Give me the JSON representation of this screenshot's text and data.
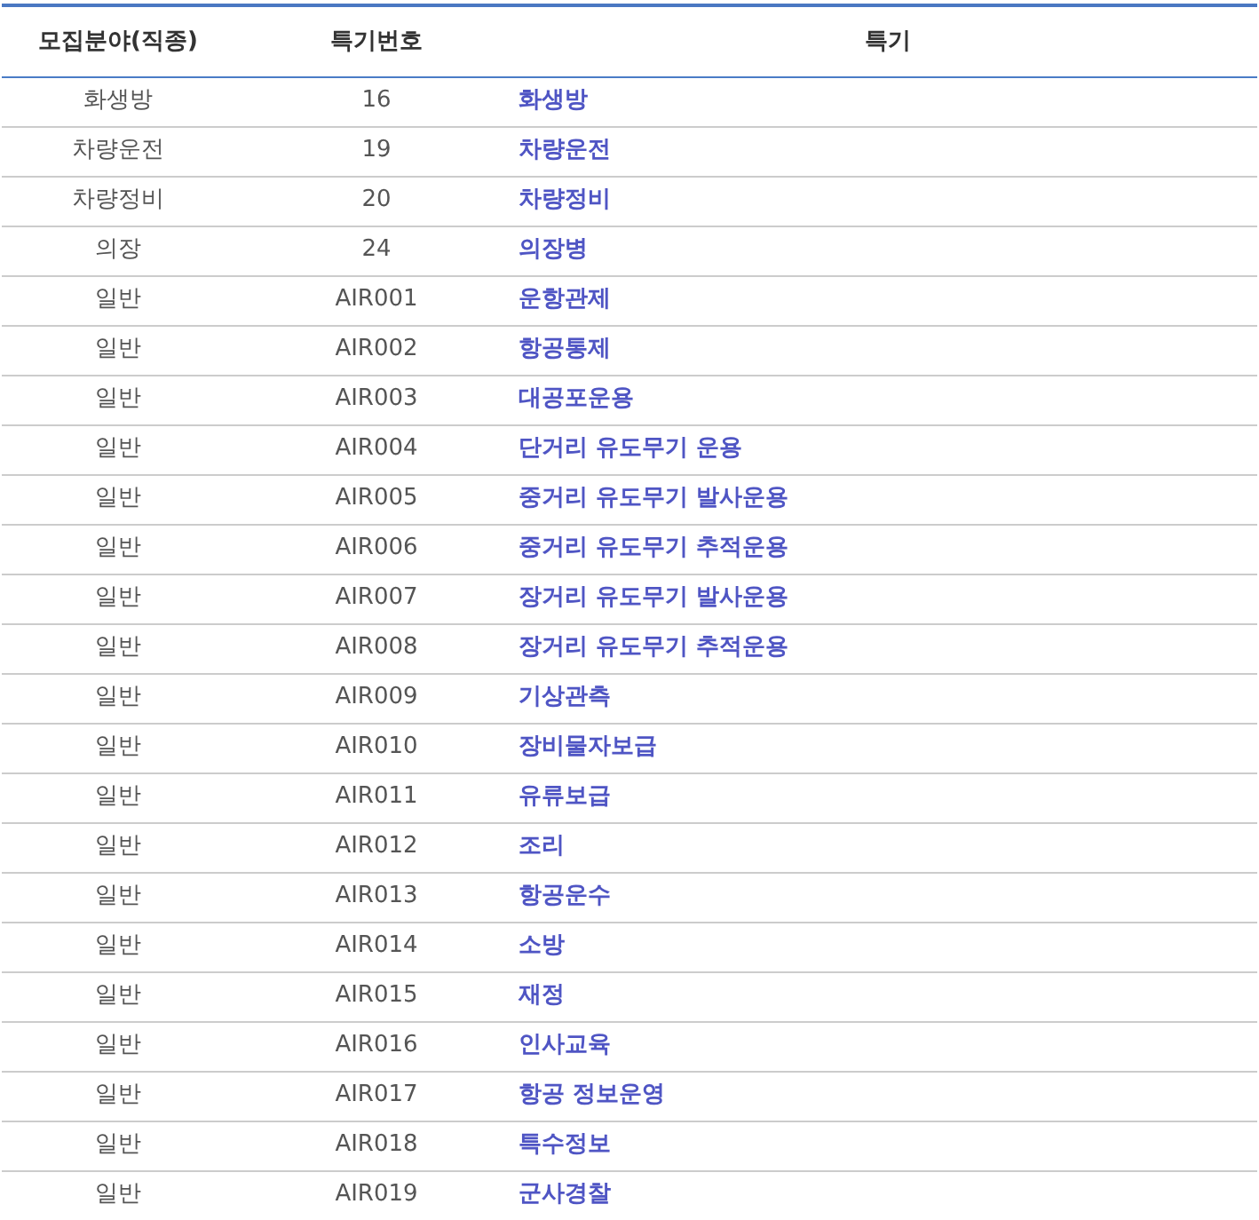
{
  "table": {
    "columns": [
      "모집분야(직종)",
      "특기번호",
      "특기"
    ],
    "rows": [
      {
        "field": "화생방",
        "code": "16",
        "specialty": "화생방"
      },
      {
        "field": "차량운전",
        "code": "19",
        "specialty": "차량운전"
      },
      {
        "field": "차량정비",
        "code": "20",
        "specialty": "차량정비"
      },
      {
        "field": "의장",
        "code": "24",
        "specialty": "의장병"
      },
      {
        "field": "일반",
        "code": "AIR001",
        "specialty": "운항관제"
      },
      {
        "field": "일반",
        "code": "AIR002",
        "specialty": "항공통제"
      },
      {
        "field": "일반",
        "code": "AIR003",
        "specialty": "대공포운용"
      },
      {
        "field": "일반",
        "code": "AIR004",
        "specialty": "단거리 유도무기 운용"
      },
      {
        "field": "일반",
        "code": "AIR005",
        "specialty": "중거리 유도무기 발사운용"
      },
      {
        "field": "일반",
        "code": "AIR006",
        "specialty": "중거리 유도무기 추적운용"
      },
      {
        "field": "일반",
        "code": "AIR007",
        "specialty": "장거리 유도무기 발사운용"
      },
      {
        "field": "일반",
        "code": "AIR008",
        "specialty": "장거리 유도무기 추적운용"
      },
      {
        "field": "일반",
        "code": "AIR009",
        "specialty": "기상관측"
      },
      {
        "field": "일반",
        "code": "AIR010",
        "specialty": "장비물자보급"
      },
      {
        "field": "일반",
        "code": "AIR011",
        "specialty": "유류보급"
      },
      {
        "field": "일반",
        "code": "AIR012",
        "specialty": "조리"
      },
      {
        "field": "일반",
        "code": "AIR013",
        "specialty": "항공운수"
      },
      {
        "field": "일반",
        "code": "AIR014",
        "specialty": "소방"
      },
      {
        "field": "일반",
        "code": "AIR015",
        "specialty": "재정"
      },
      {
        "field": "일반",
        "code": "AIR016",
        "specialty": "인사교육"
      },
      {
        "field": "일반",
        "code": "AIR017",
        "specialty": "항공 정보운영"
      },
      {
        "field": "일반",
        "code": "AIR018",
        "specialty": "특수정보"
      },
      {
        "field": "일반",
        "code": "AIR019",
        "specialty": "군사경찰"
      }
    ]
  }
}
